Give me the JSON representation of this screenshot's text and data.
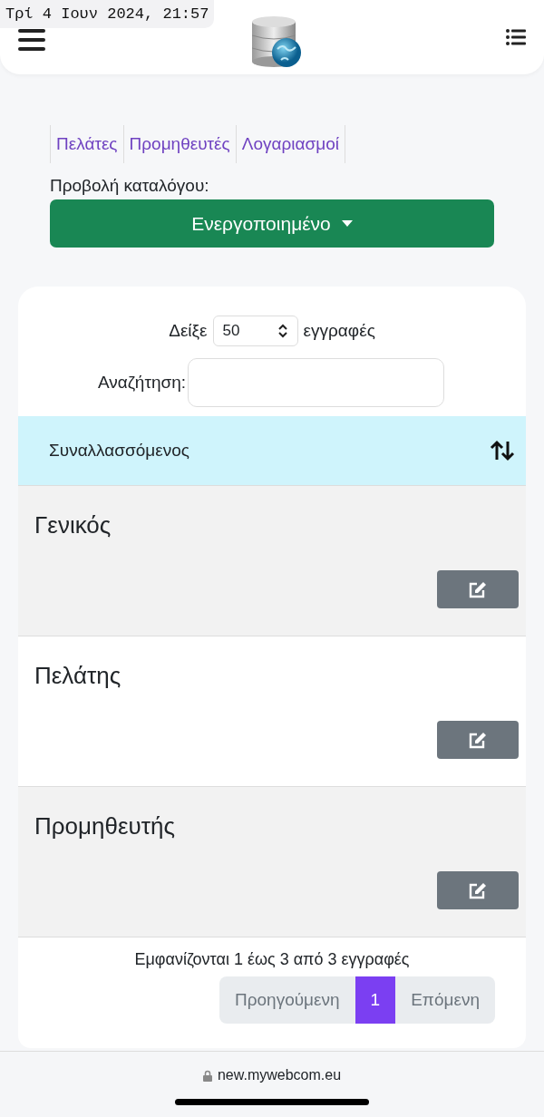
{
  "status_time": "Τρί 4 Ιουν 2024, 21:57",
  "nav_links": [
    {
      "label": "Πελάτες"
    },
    {
      "label": "Προμηθευτές"
    },
    {
      "label": "Λογαριασμοί"
    }
  ],
  "catalog": {
    "label": "Προβολή καταλόγου:",
    "value": "Ενεργοποιημένο"
  },
  "table": {
    "length_prefix": "Δείξε",
    "length_value": "50",
    "length_suffix": "εγγραφές",
    "search_label": "Αναζήτηση:",
    "columns": [
      "Συναλλασσόμενος"
    ],
    "rows": [
      {
        "name": "Γενικός"
      },
      {
        "name": "Πελάτης"
      },
      {
        "name": "Προμηθευτής"
      }
    ],
    "info": "Εμφανίζονται 1 έως 3 από 3 εγγραφές",
    "pagination": [
      {
        "label": "Προηγούμενη",
        "selected": false
      },
      {
        "label": "1",
        "selected": true
      },
      {
        "label": "Επόμενη",
        "selected": false
      }
    ]
  },
  "browser": {
    "url": "new.mywebcom.eu"
  }
}
